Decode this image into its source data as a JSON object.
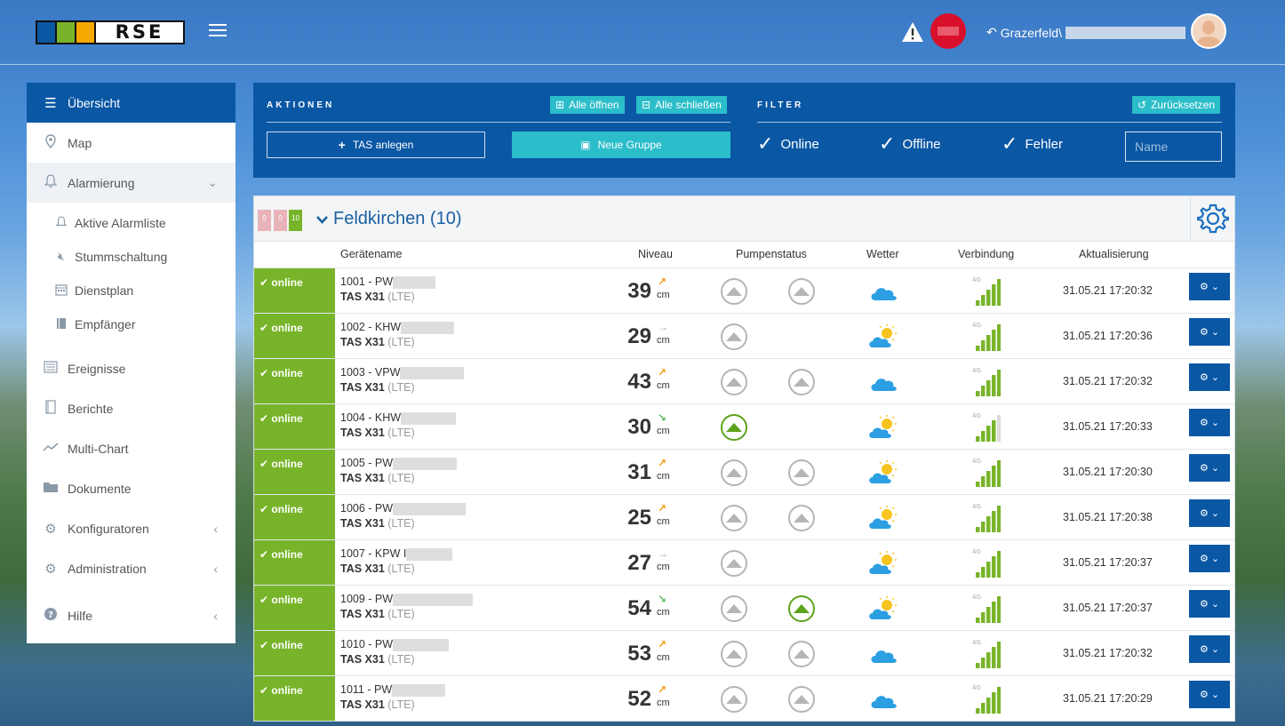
{
  "header": {
    "logo_text": "RSE",
    "logo_colors": [
      "#0a57a4",
      "#78b42a",
      "#f5a800"
    ],
    "user_path": "Grazerfeld\\"
  },
  "sidebar": {
    "items": [
      {
        "label": "Übersicht",
        "icon": "list-icon"
      },
      {
        "label": "Map",
        "icon": "map-pin-icon"
      },
      {
        "label": "Alarmierung",
        "icon": "bell-icon"
      }
    ],
    "alarm_sub": [
      {
        "label": "Aktive Alarmliste",
        "icon": "bell-icon"
      },
      {
        "label": "Stummschaltung",
        "icon": "mute-icon"
      },
      {
        "label": "Dienstplan",
        "icon": "calendar-icon"
      },
      {
        "label": "Empfänger",
        "icon": "book-icon"
      }
    ],
    "items2": [
      {
        "label": "Ereignisse",
        "icon": "events-icon"
      },
      {
        "label": "Berichte",
        "icon": "report-icon"
      },
      {
        "label": "Multi-Chart",
        "icon": "chart-icon"
      },
      {
        "label": "Dokumente",
        "icon": "folder-icon"
      },
      {
        "label": "Konfiguratoren",
        "icon": "cogs-icon"
      },
      {
        "label": "Administration",
        "icon": "gear-icon"
      },
      {
        "label": "Hilfe",
        "icon": "help-icon"
      }
    ]
  },
  "actions": {
    "title": "AKTIONEN",
    "expand_all": "Alle öffnen",
    "collapse_all": "Alle schließen",
    "create_tas": "TAS anlegen",
    "new_group": "Neue Gruppe"
  },
  "filter": {
    "title": "FILTER",
    "reset": "Zurücksetzen",
    "online": "Online",
    "offline": "Offline",
    "error": "Fehler",
    "name_placeholder": "Name"
  },
  "group": {
    "title": "Feldkirchen (10)",
    "counts": [
      "0",
      "0",
      "10"
    ],
    "count_colors": [
      "#e8b4b9",
      "#e8b4b9",
      "#78b42a"
    ]
  },
  "columns": {
    "device": "Gerätename",
    "level": "Niveau",
    "pump": "Pumpenstatus",
    "weather": "Wetter",
    "connection": "Verbindung",
    "updated": "Aktualisierung"
  },
  "rows": [
    {
      "status": "online",
      "name": "1001 - PW",
      "model": "TAS X31",
      "net": "(LTE)",
      "level": "39",
      "unit": "cm",
      "trend": "up",
      "pumps": [
        "off",
        "off"
      ],
      "weather": "cloud",
      "signal_bars": 5,
      "updated": "31.05.21 17:20:32"
    },
    {
      "status": "online",
      "name": "1002 - KHW",
      "model": "TAS X31",
      "net": "(LTE)",
      "level": "29",
      "unit": "cm",
      "trend": "flat",
      "pumps": [
        "off"
      ],
      "weather": "sun-cloud",
      "signal_bars": 5,
      "updated": "31.05.21 17:20:36"
    },
    {
      "status": "online",
      "name": "1003 - VPW",
      "model": "TAS X31",
      "net": "(LTE)",
      "level": "43",
      "unit": "cm",
      "trend": "up",
      "pumps": [
        "off",
        "off"
      ],
      "weather": "cloud",
      "signal_bars": 5,
      "updated": "31.05.21 17:20:32"
    },
    {
      "status": "online",
      "name": "1004 - KHW",
      "model": "TAS X31",
      "net": "(LTE)",
      "level": "30",
      "unit": "cm",
      "trend": "down",
      "pumps": [
        "on"
      ],
      "weather": "sun-cloud",
      "signal_bars": 4,
      "updated": "31.05.21 17:20:33"
    },
    {
      "status": "online",
      "name": "1005 - PW",
      "model": "TAS X31",
      "net": "(LTE)",
      "level": "31",
      "unit": "cm",
      "trend": "up",
      "pumps": [
        "off",
        "off"
      ],
      "weather": "sun-cloud",
      "signal_bars": 5,
      "updated": "31.05.21 17:20:30"
    },
    {
      "status": "online",
      "name": "1006 - PW",
      "model": "TAS X31",
      "net": "(LTE)",
      "level": "25",
      "unit": "cm",
      "trend": "up",
      "pumps": [
        "off",
        "off"
      ],
      "weather": "sun-cloud",
      "signal_bars": 5,
      "updated": "31.05.21 17:20:38"
    },
    {
      "status": "online",
      "name": "1007 - KPW I",
      "model": "TAS X31",
      "net": "(LTE)",
      "level": "27",
      "unit": "cm",
      "trend": "flat",
      "pumps": [
        "off"
      ],
      "weather": "sun-cloud",
      "signal_bars": 5,
      "updated": "31.05.21 17:20:37"
    },
    {
      "status": "online",
      "name": "1009 - PW",
      "model": "TAS X31",
      "net": "(LTE)",
      "level": "54",
      "unit": "cm",
      "trend": "down",
      "pumps": [
        "off",
        "on"
      ],
      "weather": "sun-cloud",
      "signal_bars": 5,
      "updated": "31.05.21 17:20:37"
    },
    {
      "status": "online",
      "name": "1010 - PW",
      "model": "TAS X31",
      "net": "(LTE)",
      "level": "53",
      "unit": "cm",
      "trend": "up",
      "pumps": [
        "off",
        "off"
      ],
      "weather": "cloud",
      "signal_bars": 5,
      "updated": "31.05.21 17:20:32"
    },
    {
      "status": "online",
      "name": "1011 - PW",
      "model": "TAS X31",
      "net": "(LTE)",
      "level": "52",
      "unit": "cm",
      "trend": "up",
      "pumps": [
        "off",
        "off"
      ],
      "weather": "cloud",
      "signal_bars": 5,
      "updated": "31.05.21 17:20:29"
    }
  ]
}
